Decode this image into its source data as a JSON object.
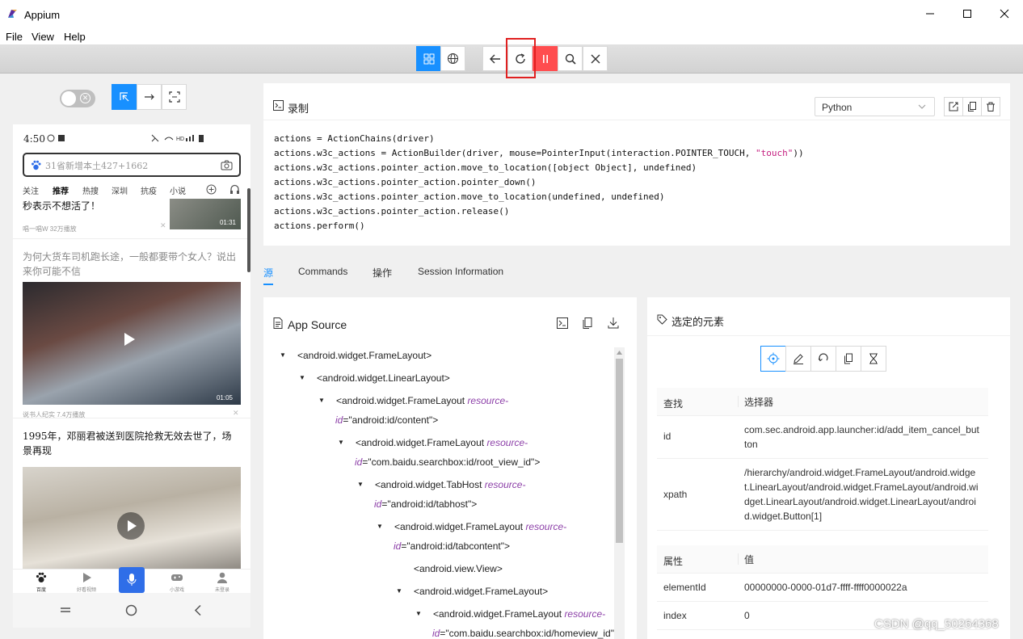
{
  "window": {
    "title": "Appium"
  },
  "menu": {
    "file": "File",
    "view": "View",
    "help": "Help"
  },
  "toolbar": {
    "buttons": [
      "grid-view-icon",
      "globe-icon",
      "back-arrow-icon",
      "refresh-icon",
      "pause-icon",
      "search-icon",
      "close-icon"
    ]
  },
  "phone": {
    "time": "4:50",
    "search_placeholder": "31省新增本土427+1662",
    "tabs": [
      "关注",
      "推荐",
      "热搜",
      "深圳",
      "抗疫",
      "小说"
    ],
    "feed": [
      {
        "title": "秒表示不想活了！",
        "meta": "唱一唱W 32万播放",
        "duration": "01:31"
      },
      {
        "title": "为何大货车司机跑长途，一般都要带个女人？说出来你可能不信",
        "meta": "说书人纪实 7.4万播放",
        "duration": "01:05"
      },
      {
        "title": "1995年，邓丽君被送到医院抢救无效去世了，场景再现"
      }
    ],
    "bottom_nav": [
      "百度",
      "好看视频",
      "",
      "小游戏",
      "未登录"
    ]
  },
  "recorder": {
    "title": "录制",
    "language": "Python",
    "code_lines": [
      "actions = ActionChains(driver)",
      "actions.w3c_actions = ActionBuilder(driver, mouse=PointerInput(interaction.POINTER_TOUCH, ",
      "actions.w3c_actions.pointer_action.move_to_location([object Object], undefined)",
      "actions.w3c_actions.pointer_action.pointer_down()",
      "actions.w3c_actions.pointer_action.move_to_location(undefined, undefined)",
      "actions.w3c_actions.pointer_action.release()",
      "actions.perform()"
    ],
    "code_string": "\"touch\"",
    "code_tail": "))"
  },
  "tabs": [
    "源",
    "Commands",
    "操作",
    "Session Information"
  ],
  "source": {
    "title": "App Source",
    "nodes": [
      {
        "tag": "<android.widget.FrameLayout>"
      },
      {
        "tag": "<android.widget.LinearLayout>"
      },
      {
        "tag": "<android.widget.FrameLayout",
        "attr": "resource-",
        "attr2": "id",
        "val": "=\"android:id/content\">"
      },
      {
        "tag": "<android.widget.FrameLayout",
        "attr": "resource-",
        "attr2": "id",
        "val": "=\"com.baidu.searchbox:id/root_view_id\">"
      },
      {
        "tag": "<android.widget.TabHost",
        "attr": "resource-",
        "attr2": "id",
        "val": "=\"android:id/tabhost\">"
      },
      {
        "tag": "<android.widget.FrameLayout",
        "attr": "resource-",
        "attr2": "id",
        "val": "=\"android:id/tabcontent\">"
      },
      {
        "tag": "<android.view.View>"
      },
      {
        "tag": "<android.widget.FrameLayout>"
      },
      {
        "tag": "<android.widget.FrameLayout",
        "attr": "resource-",
        "attr2": "id",
        "val": "=\"com.baidu.searchbox:id/homeview_id\""
      }
    ]
  },
  "element": {
    "title": "选定的元素",
    "find_header": {
      "key": "查找",
      "value": "选择器"
    },
    "find_rows": [
      {
        "key": "id",
        "value": "com.sec.android.app.launcher:id/add_item_cancel_button"
      },
      {
        "key": "xpath",
        "value": "/hierarchy/android.widget.FrameLayout/android.widget.LinearLayout/android.widget.FrameLayout/android.widget.LinearLayout/android.widget.LinearLayout/android.widget.Button[1]"
      }
    ],
    "attr_header": {
      "key": "属性",
      "value": "值"
    },
    "attr_rows": [
      {
        "key": "elementId",
        "value": "00000000-0000-01d7-ffff-ffff0000022a"
      },
      {
        "key": "index",
        "value": "0"
      }
    ]
  },
  "watermark": "CSDN @qq_50264368",
  "colors": {
    "accent": "#1890ff",
    "danger": "#ff4d4f",
    "highlight": "#e02020"
  }
}
